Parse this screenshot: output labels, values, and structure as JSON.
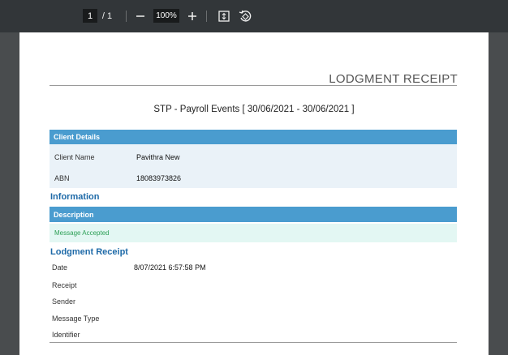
{
  "toolbar": {
    "current_page": "1",
    "page_separator": "/",
    "total_pages": "1",
    "zoom_level": "100%",
    "zoom_out_icon": "minus-icon",
    "zoom_in_icon": "plus-icon",
    "fit_icon": "fit-page-icon",
    "rotate_icon": "rotate-icon"
  },
  "document": {
    "title": "LODGMENT RECEIPT",
    "subtitle": "STP - Payroll Events [ 30/06/2021 - 30/06/2021 ]",
    "client_details": {
      "header": "Client Details",
      "client_name_label": "Client Name",
      "client_name_value": "Pavithra New",
      "abn_label": "ABN",
      "abn_value": "18083973826"
    },
    "information": {
      "heading": "Information",
      "header": "Description",
      "message": "Message Accepted"
    },
    "lodgment_receipt": {
      "heading": "Lodgment Receipt",
      "rows": [
        {
          "label": "Date",
          "value": "8/07/2021 6:57:58 PM"
        },
        {
          "label": "Receipt",
          "value": ""
        },
        {
          "label": "Sender",
          "value": ""
        },
        {
          "label": "Message Type",
          "value": ""
        },
        {
          "label": "Identifier",
          "value": ""
        }
      ]
    }
  },
  "colors": {
    "toolbar_bg": "#323639",
    "viewer_bg": "#525659",
    "header_bar": "#4a9ccf",
    "section_title": "#1e6aa8",
    "accepted_text": "#2c9f55"
  }
}
